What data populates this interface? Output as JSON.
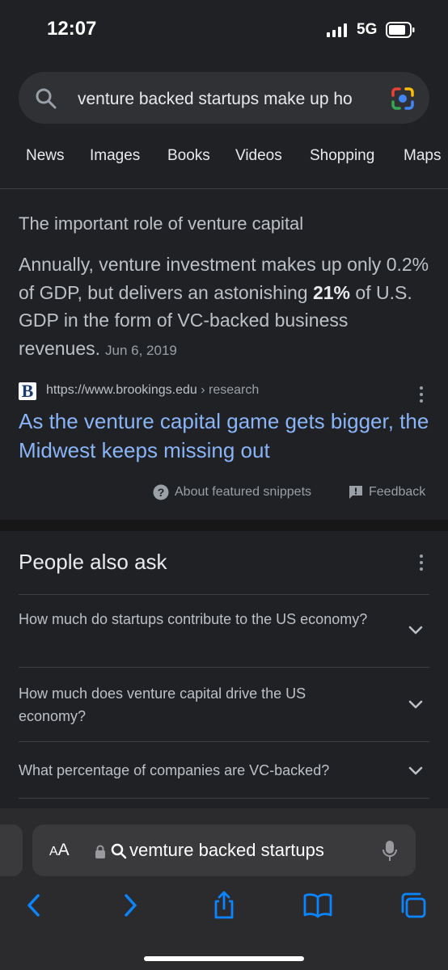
{
  "status": {
    "time": "12:07",
    "network": "5G"
  },
  "search": {
    "query": "venture backed startups make up ho",
    "icon": "search-icon",
    "lens_icon": "google-lens-icon"
  },
  "tabs": [
    "News",
    "Images",
    "Books",
    "Videos",
    "Shopping",
    "Maps"
  ],
  "snippet": {
    "title": "The important role of venture capital",
    "body_part1": "Annually, venture investment makes up only 0.2% of GDP, but delivers an astonishing ",
    "body_bold": "21%",
    "body_part2": " of U.S. GDP in the form of VC-backed business revenues.",
    "date": "Jun 6, 2019",
    "favicon_letter": "B",
    "source_url": "https://www.brookings.edu",
    "source_crumb": " › research",
    "link_title": "As the venture capital game gets bigger, the Midwest keeps missing out",
    "about_label": "About featured snippets",
    "feedback_label": "Feedback"
  },
  "people_also_ask": {
    "title": "People also ask",
    "questions": [
      "How much do startups contribute to the US economy?",
      "How much does venture capital drive the US economy?",
      "What percentage of companies are VC-backed?"
    ]
  },
  "browser": {
    "aa_label_small": "A",
    "aa_label": "A",
    "address_text": "vemture backed startups",
    "nav_icons": [
      "back-icon",
      "forward-icon",
      "share-icon",
      "bookmarks-icon",
      "tabs-icon"
    ]
  },
  "colors": {
    "background": "#202124",
    "link": "#8ab4f8",
    "text": "#bdc1c6",
    "accent_ios": "#0a84ff"
  }
}
